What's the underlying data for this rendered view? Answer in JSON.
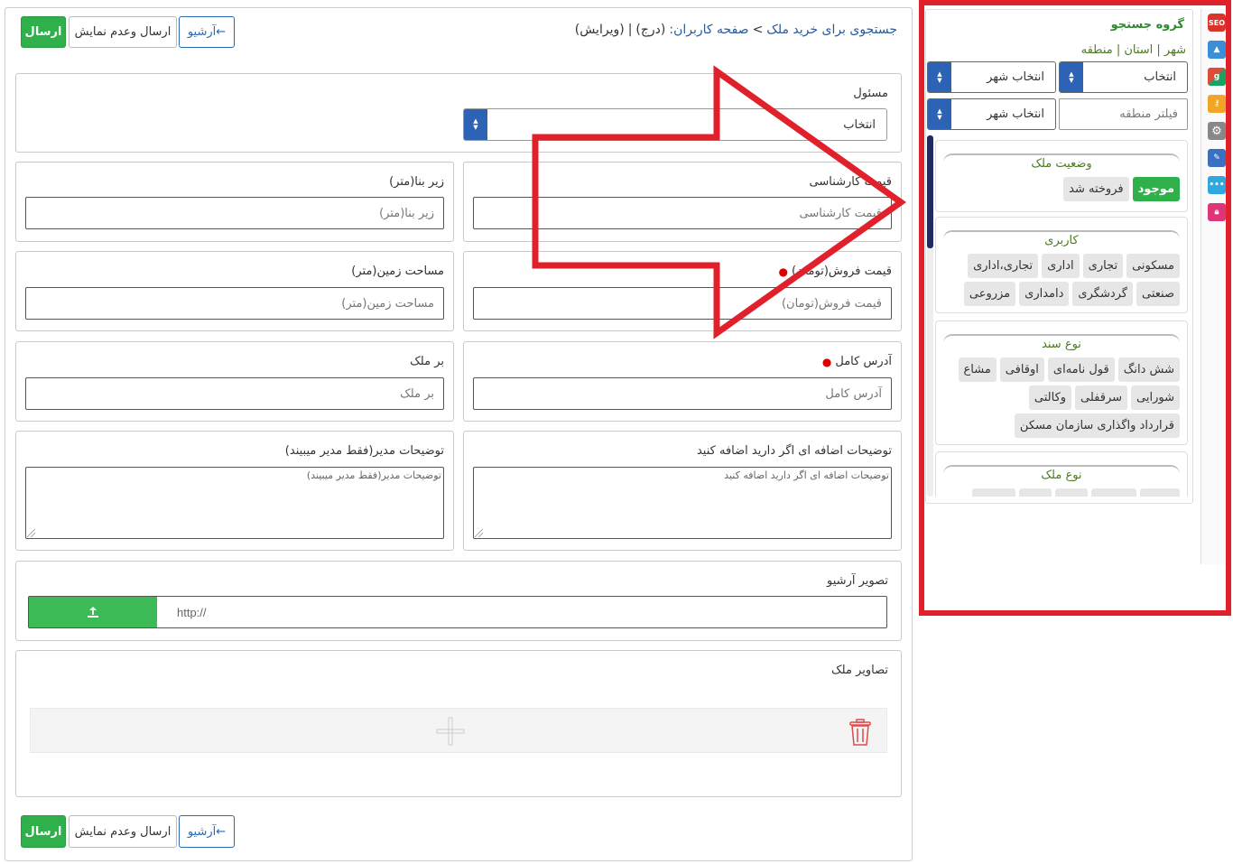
{
  "breadcrumb": {
    "main": "جستجوی برای خرید ملک",
    "sep": ">",
    "page": "صفحه کاربران:",
    "insert": "(درج)",
    "pipe": "|",
    "edit": "(ویرایش)"
  },
  "toolbar": {
    "send_label": "ارسال",
    "send_hide_label": "ارسال وعدم نمایش",
    "archive_label": "آرشیو←"
  },
  "form": {
    "responsible": {
      "label": "مسئول",
      "value": "انتخاب"
    },
    "expert_price": {
      "label": "قیمت کارشناسی",
      "placeholder": "قیمت کارشناسی"
    },
    "built_area": {
      "label": "زیر بنا(متر)",
      "placeholder": "زیر بنا(متر)"
    },
    "sale_price": {
      "label": "قیمت فروش(تومان)",
      "placeholder": "قیمت فروش(تومان)"
    },
    "land_area": {
      "label": "مساحت زمین(متر)",
      "placeholder": "مساحت زمین(متر)"
    },
    "address": {
      "label": "آدرس کامل",
      "placeholder": "آدرس کامل"
    },
    "frontage": {
      "label": "بر ملک",
      "placeholder": "بر ملک"
    },
    "extra_desc": {
      "label": "توضیحات اضافه ای اگر دارید اضافه کنید",
      "placeholder": "توضیحات اضافه ای اگر دارید اضافه کنید"
    },
    "admin_desc": {
      "label": "توضیحات مدیر(فقط مدیر میبیند)",
      "placeholder": "توضیحات مدیر(فقط مدیر میبیند)"
    },
    "archive_image": {
      "label": "تصویر آرشیو",
      "placeholder": "http://"
    },
    "property_images": {
      "label": "تصاویر ملک"
    }
  },
  "sidebar": {
    "title": "گروه جستجو",
    "location_label": "شهر | استان | منطقه",
    "select_1": "انتخاب",
    "select_city_1": "انتخاب شهر",
    "region_filter_placeholder": "فیلتر منطقه",
    "select_city_2": "انتخاب شهر",
    "status": {
      "title": "وضعیت ملک",
      "items": [
        "موجود",
        "فروخته شد"
      ]
    },
    "usage": {
      "title": "کاربری",
      "items": [
        "مسکونی",
        "تجاری",
        "اداری",
        "تجاری،اداری",
        "صنعتی",
        "گردشگری",
        "دامداری",
        "مزروعی"
      ]
    },
    "deed": {
      "title": "نوع سند",
      "items": [
        "شش دانگ",
        "قول نامه‌ای",
        "اوقافی",
        "مشاع",
        "شورایی",
        "سرقفلی",
        "وکالتی",
        "قرارداد واگذاری سازمان مسکن"
      ]
    },
    "type": {
      "title": "نوع ملک"
    }
  },
  "side_icons": [
    "seo-icon",
    "upload-icon",
    "google-icon",
    "key-icon",
    "gear-icon",
    "tools-icon",
    "more-icon",
    "lock-icon"
  ],
  "colors": {
    "green": "#2fb04a",
    "blue": "#2c63b4",
    "red_annotation": "#e0202a"
  }
}
